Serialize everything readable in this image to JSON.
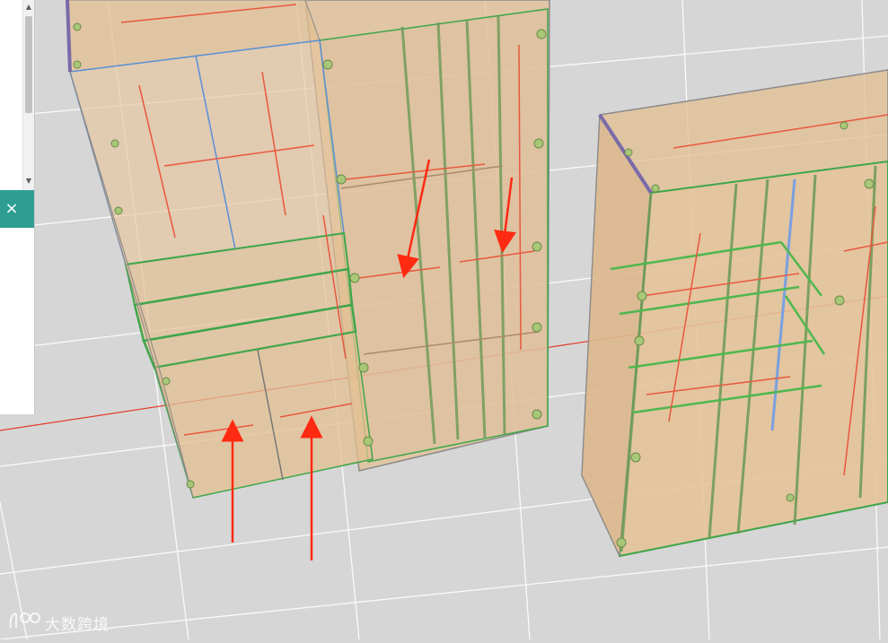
{
  "panel": {
    "close_icon": "×"
  },
  "watermark": {
    "text": "大数跨境"
  },
  "colors": {
    "floor": "#d6d6d6",
    "grid": "#ffffff",
    "panel_tint": "#e3bf91",
    "edge_green": "#3ea64a",
    "edge_blue": "#5a8fd6",
    "edge_purple": "#7a6aa8",
    "annotation_arrow": "#ff2a12",
    "accent_teal": "#2e9e93"
  }
}
